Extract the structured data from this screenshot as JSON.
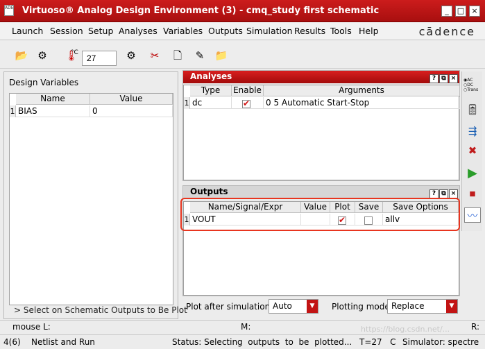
{
  "window": {
    "title": "Virtuoso® Analog Design Environment (3) - cmq_study first schematic",
    "app_icon_text": "ADE",
    "controls": {
      "minimize": "_",
      "maximize": "□",
      "close": "×"
    }
  },
  "menu": {
    "items": [
      "Launch",
      "Session",
      "Setup",
      "Analyses",
      "Variables",
      "Outputs",
      "Simulation",
      "Results",
      "Tools",
      "Help"
    ],
    "brand": "cādence"
  },
  "toolbar": {
    "temperature_unit": "°C",
    "temperature_value": "27",
    "icons": [
      "open-icon",
      "gears-icon",
      "thermometer-icon",
      "settings-icon",
      "scissors-icon",
      "document-icon",
      "edit-icon",
      "folder-icon"
    ]
  },
  "design_variables": {
    "label": "Design Variables",
    "columns": [
      "Name",
      "Value"
    ],
    "rows": [
      {
        "num": "1",
        "name": "BIAS",
        "value": "0"
      }
    ],
    "footer": "> Select on Schematic Outputs to Be Plot"
  },
  "analyses": {
    "title": "Analyses",
    "columns": [
      "Type",
      "Enable",
      "Arguments"
    ],
    "rows": [
      {
        "num": "1",
        "type": "dc",
        "enable": true,
        "arguments": "0 5 Automatic Start-Stop"
      }
    ]
  },
  "outputs": {
    "title": "Outputs",
    "columns": [
      "Name/Signal/Expr",
      "Value",
      "Plot",
      "Save",
      "Save Options"
    ],
    "rows": [
      {
        "num": "1",
        "name": "VOUT",
        "value": "",
        "plot": true,
        "save": false,
        "save_options": "allv"
      }
    ]
  },
  "side_tools": {
    "radio": [
      "AC",
      "DC",
      "Trans"
    ]
  },
  "bottom_controls": {
    "plot_after_label": "Plot after simulation:",
    "plot_after_value": "Auto",
    "plotting_mode_label": "Plotting mode:",
    "plotting_mode_value": "Replace"
  },
  "mouse_bar": {
    "left": "mouse L:",
    "mid": "M:",
    "right": "R:"
  },
  "status_bar": {
    "counter": "4(6)",
    "action": "Netlist and Run",
    "status": "Status: Selecting  outputs  to  be  plotted...",
    "temp": "T=27   C",
    "simulator": "Simulator: spectre"
  },
  "watermark": "https://blog.csdn.net/..."
}
